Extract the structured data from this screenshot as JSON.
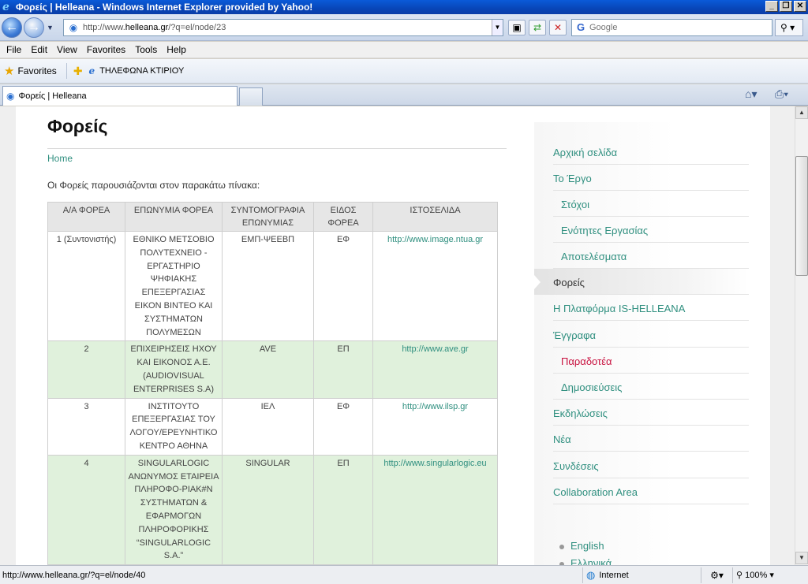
{
  "window": {
    "title": "Φορείς | Helleana - Windows Internet Explorer provided by Yahoo!",
    "controls": [
      "_",
      "❐",
      "✕"
    ]
  },
  "navbar": {
    "url_prefix": "http://www.",
    "url_domain": "helleana.gr",
    "url_suffix": "/?q=el/node/23",
    "search_placeholder": "Google"
  },
  "menubar": {
    "items": [
      "File",
      "Edit",
      "View",
      "Favorites",
      "Tools",
      "Help"
    ]
  },
  "favorites": {
    "label": "Favorites",
    "link": "ΤΗΛΕΦΩΝΑ ΚΤΙΡΙΟΥ"
  },
  "tabs": {
    "active_title": "Φορείς | Helleana"
  },
  "page": {
    "title": "Φορείς",
    "breadcrumb": "Home",
    "intro": "Οι Φορείς παρουσιάζονται στον παρακάτω πίνακα:",
    "table": {
      "headers": [
        "Α/Α ΦΟΡΕΑ",
        "ΕΠΩΝΥΜΙΑ ΦΟΡΕΑ",
        "ΣΥΝΤΟΜΟΓΡΑΦΙΑ ΕΠΩΝΥΜΙΑΣ",
        "ΕΙΔΟΣ ΦΟΡΕΑ",
        "ΙΣΤΟΣΕΛΙΔΑ"
      ],
      "rows": [
        [
          "1 (Συντονιστής)",
          "ΕΘΝΙΚΟ ΜΕΤΣΟΒΙΟ ΠΟΛΥΤΕΧΝΕΙΟ - ΕΡΓΑΣΤΗΡΙΟ ΨΗΦΙΑΚΗΣ ΕΠΕΞΕΡΓΑΣΙΑΣ ΕΙΚΟΝ ΒΙΝΤΕΟ ΚΑΙ ΣΥΣΤΗΜΑΤΩΝ ΠΟΛΥΜΕΣΩΝ",
          "ΕΜΠ-ΨΕΕΒΠ",
          "ΕΦ",
          "http://www.image.ntua.gr"
        ],
        [
          "2",
          "ΕΠΙΧΕΙΡΗΣΕΙΣ ΗΧΟΥ ΚΑΙ ΕΙΚΟΝΟΣ Α.Ε. (AUDIOVISUAL ENTERPRISES S.A)",
          "AVE",
          "ΕΠ",
          "http://www.ave.gr"
        ],
        [
          "3",
          "ΙΝΣΤΙΤΟΥΤΟ ΕΠΕΞΕΡΓΑΣΙΑΣ ΤΟΥ ΛΟΓΟΥ/ΕΡΕΥΝΗΤΙΚΟ ΚΕΝΤΡΟ ΑΘΗΝΑ",
          "ΙΕΛ",
          "ΕΦ",
          "http://www.ilsp.gr"
        ],
        [
          "4",
          "SINGULARLOGIC ΑΝΩΝΥΜΟΣ ΕΤΑΙΡΕΙΑ ΠΛΗΡΟΦΟ-ΡΙΑΚ#Ν ΣΥΣΤΗΜΑΤΩΝ & ΕΦΑΡΜΟΓΩΝ ΠΛΗΡΟΦΟΡΙΚΗΣ “SINGULARLOGIC S.A.”",
          "SINGULAR",
          "ΕΠ",
          "http://www.singularlogic.eu"
        ]
      ]
    }
  },
  "sidebar": {
    "items": [
      {
        "label": "Αρχική σελίδα",
        "type": "top"
      },
      {
        "label": "Το Έργο",
        "type": "top"
      },
      {
        "label": "Στόχοι",
        "type": "sub"
      },
      {
        "label": "Ενότητες Εργασίας",
        "type": "sub"
      },
      {
        "label": "Αποτελέσματα",
        "type": "sub"
      },
      {
        "label": "Φορείς",
        "type": "active"
      },
      {
        "label": "Η Πλατφόρμα IS-HELLEANA",
        "type": "top"
      },
      {
        "label": "Έγγραφα",
        "type": "top"
      },
      {
        "label": "Παραδοτέα",
        "type": "current"
      },
      {
        "label": "Δημοσιεύσεις",
        "type": "sub"
      },
      {
        "label": "Εκδηλώσεις",
        "type": "top"
      },
      {
        "label": "Νέα",
        "type": "top"
      },
      {
        "label": "Συνδέσεις",
        "type": "top"
      },
      {
        "label": "Collaboration Area",
        "type": "top"
      }
    ],
    "languages": [
      "English",
      "Ελληνικά"
    ]
  },
  "statusbar": {
    "text": "http://www.helleana.gr/?q=el/node/40",
    "zone": "Internet",
    "zoom": "100%"
  }
}
